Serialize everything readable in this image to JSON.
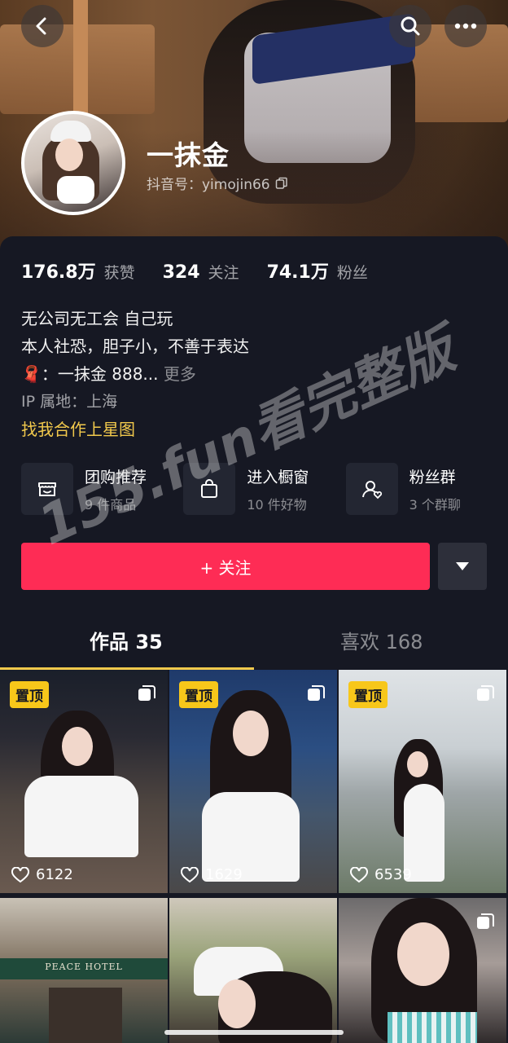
{
  "header": {
    "name": "一抹金",
    "douyin_id": "抖音号：yimojin66"
  },
  "stats": [
    {
      "num": "176.8万",
      "label": "获赞"
    },
    {
      "num": "324",
      "label": "关注"
    },
    {
      "num": "74.1万",
      "label": "粉丝"
    }
  ],
  "bio": {
    "line1": "无公司无工会 自己玩",
    "line2": "本人社恐，胆子小，不善于表达",
    "line3_emoji": "🧣",
    "line3_text": "：一抹金 888...",
    "more": "更多",
    "ip": "IP 属地：上海",
    "collab": "找我合作上星图"
  },
  "services": [
    {
      "title": "团购推荐",
      "sub": "9 件商品",
      "icon": "group-buy-icon"
    },
    {
      "title": "进入橱窗",
      "sub": "10 件好物",
      "icon": "shopping-bag-icon"
    },
    {
      "title": "粉丝群",
      "sub": "3 个群聊",
      "icon": "fan-group-icon"
    }
  ],
  "follow_label": "+ 关注",
  "tabs": [
    {
      "label": "作品 35",
      "active": true
    },
    {
      "label": "喜欢 168",
      "active": false
    }
  ],
  "videos": [
    {
      "pinned": "置顶",
      "likes": "6122"
    },
    {
      "pinned": "置顶",
      "likes": "1629"
    },
    {
      "pinned": "置顶",
      "likes": "6539"
    },
    {
      "pinned": "",
      "likes": "",
      "sign_text": "PEACE HOTEL"
    },
    {
      "pinned": "",
      "likes": ""
    },
    {
      "pinned": "",
      "likes": ""
    }
  ],
  "watermark": "155.fun看完整版",
  "colors": {
    "background": "#161823",
    "accent": "#fe2c55",
    "gold": "#f2c94c",
    "pin": "#f7c71a"
  }
}
